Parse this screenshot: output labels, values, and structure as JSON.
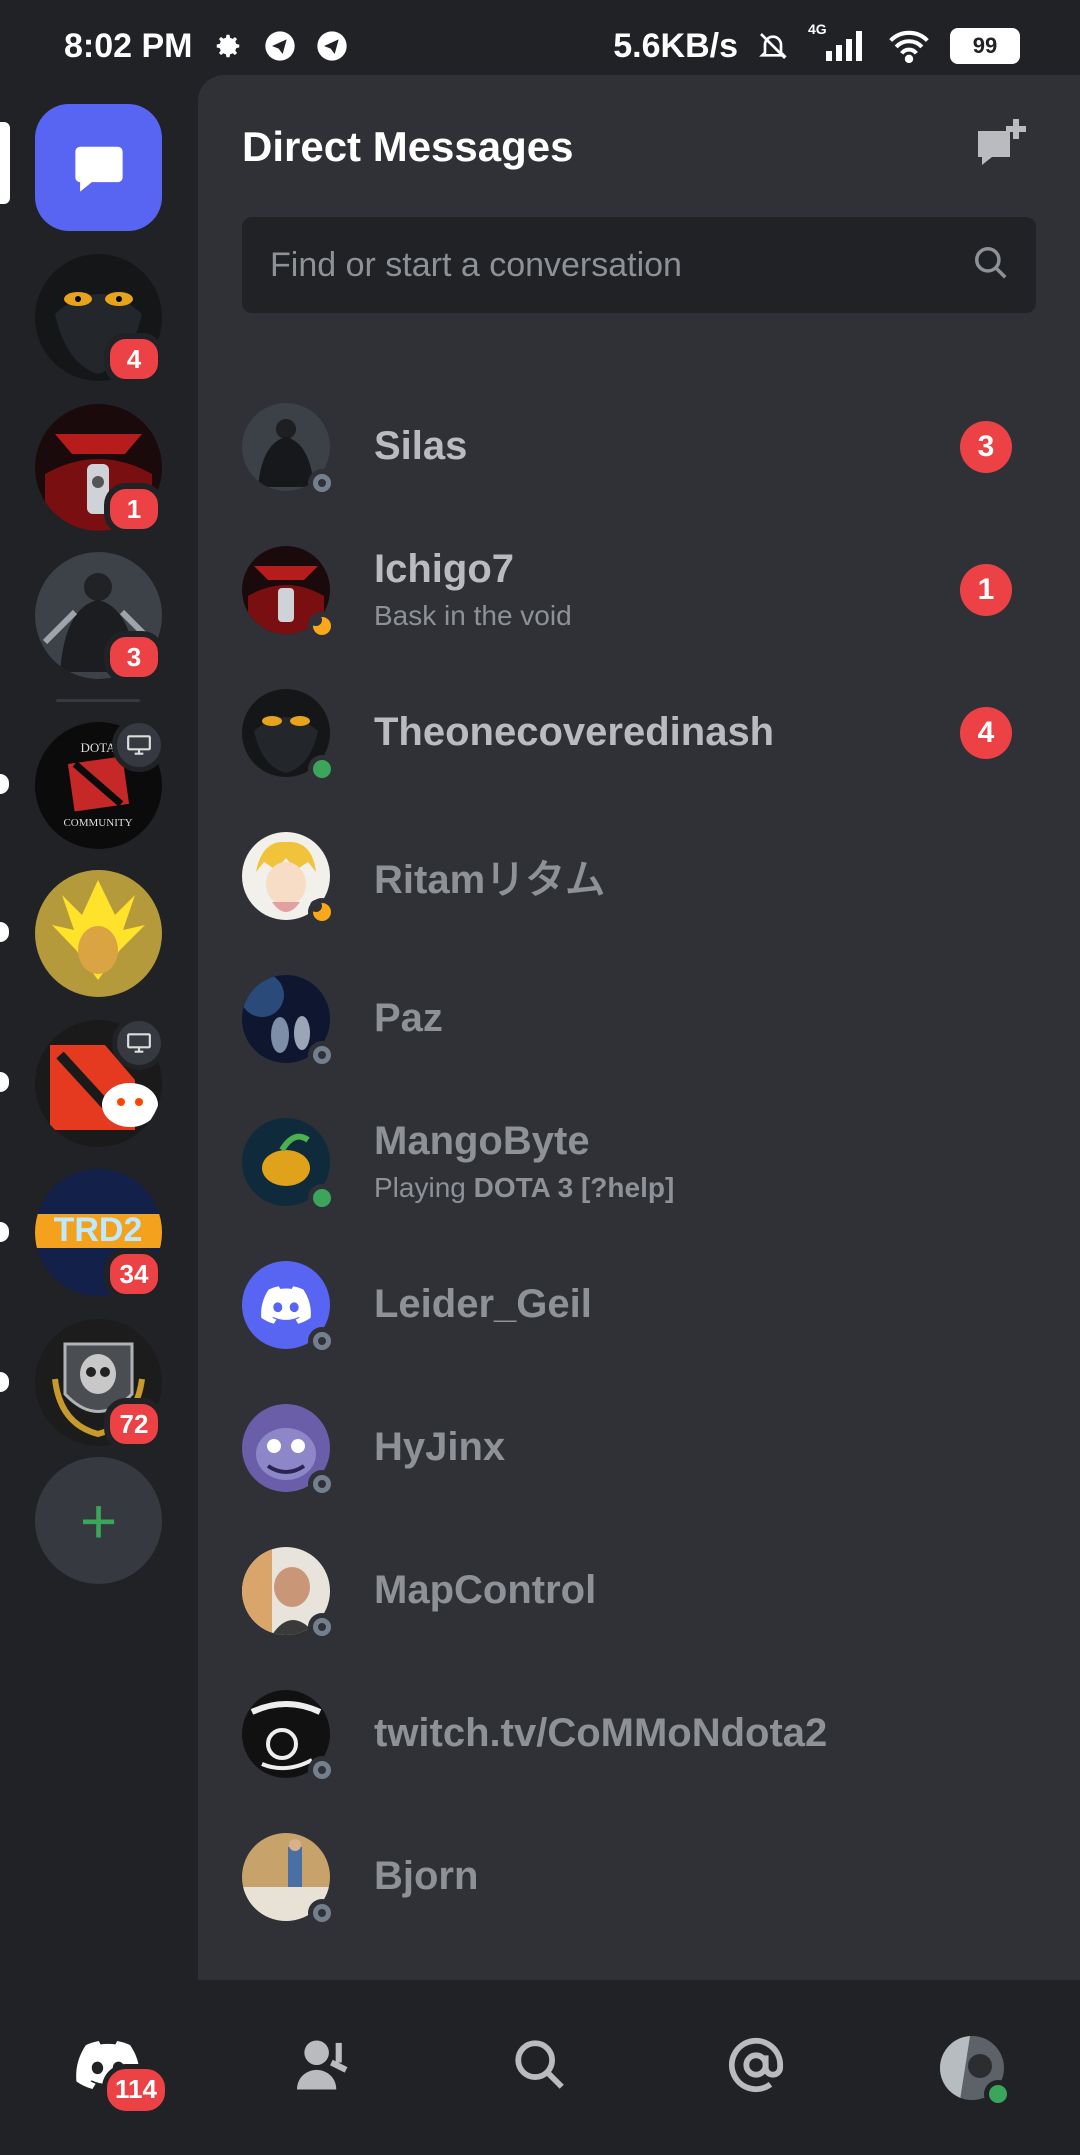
{
  "status_bar": {
    "time": "8:02 PM",
    "net_speed": "5.6KB/s",
    "network_type": "4G",
    "battery": "99",
    "icons": [
      "gear-icon",
      "telegram-icon",
      "telegram-icon",
      "bell-muted-icon",
      "signal-icon",
      "wifi-icon",
      "battery-icon"
    ]
  },
  "rail": {
    "servers": [
      {
        "name": "server-owl",
        "badge": "4"
      },
      {
        "name": "server-hellsing",
        "badge": "1"
      },
      {
        "name": "server-warrior",
        "badge": "3"
      },
      {
        "name": "server-dota-community",
        "badge": ""
      },
      {
        "name": "server-yellow-hero",
        "badge": ""
      },
      {
        "name": "server-dota-reddit",
        "badge": ""
      },
      {
        "name": "server-trd2",
        "badge": "34"
      },
      {
        "name": "server-skull",
        "badge": "72"
      }
    ]
  },
  "panel": {
    "title": "Direct Messages",
    "search_placeholder": "Find or start a conversation"
  },
  "dms": [
    {
      "name": "Silas",
      "status": "offline",
      "sub": "",
      "badge": "3"
    },
    {
      "name": "Ichigo7",
      "status": "idle",
      "sub": "Bask in the void",
      "badge": "1"
    },
    {
      "name": "Theonecoveredinash",
      "status": "online",
      "sub": "",
      "badge": "4"
    },
    {
      "name": "Ritamリタム",
      "status": "idle",
      "sub": "",
      "badge": ""
    },
    {
      "name": "Paz",
      "status": "offline",
      "sub": "",
      "badge": ""
    },
    {
      "name": "MangoByte",
      "status": "online",
      "sub_prefix": "Playing ",
      "sub_bold": "DOTA 3 [?help]",
      "badge": ""
    },
    {
      "name": "Leider_Geil",
      "status": "offline",
      "sub": "",
      "badge": ""
    },
    {
      "name": "HyJinx",
      "status": "offline",
      "sub": "",
      "badge": ""
    },
    {
      "name": "MapControl",
      "status": "offline",
      "sub": "",
      "badge": ""
    },
    {
      "name": "twitch.tv/CoMMoNdota2",
      "status": "offline",
      "sub": "",
      "badge": ""
    },
    {
      "name": "Bjorn",
      "status": "offline",
      "sub": "",
      "badge": ""
    }
  ],
  "bottom_nav": {
    "home_badge": "114",
    "items": [
      "home-icon",
      "friends-icon",
      "search-icon",
      "mentions-icon",
      "profile-avatar"
    ]
  },
  "colors": {
    "blurple": "#5865f2",
    "red_badge": "#ed4245",
    "online": "#3ba55c",
    "idle": "#faa81a",
    "background": "#202225",
    "panel": "#2f3136"
  }
}
